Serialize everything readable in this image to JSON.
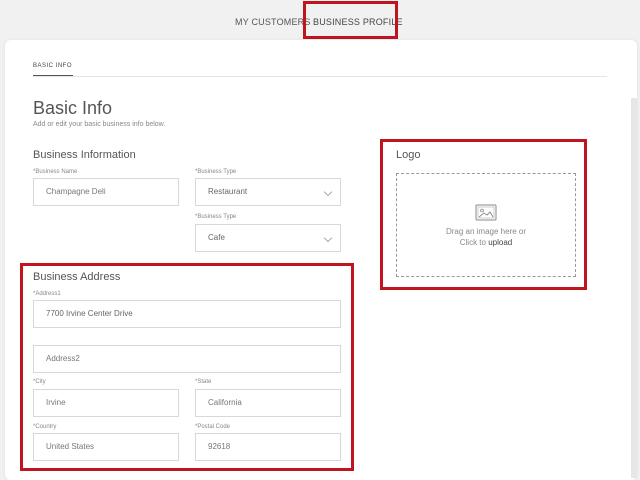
{
  "nav": {
    "tabs": [
      {
        "label": "MY CUSTOMERS"
      },
      {
        "label": "BUSINESS PROFILE"
      }
    ]
  },
  "subtab": {
    "label": "BASIC INFO"
  },
  "page": {
    "title": "Basic Info",
    "subtitle": "Add or edit your basic business info below."
  },
  "business_info": {
    "title": "Business Information",
    "name": {
      "label": "*Business Name",
      "value": "Champagne Deli"
    },
    "type1": {
      "label": "*Business Type",
      "value": "Restaurant"
    },
    "type2": {
      "label": "*Business Type",
      "value": "Cafe"
    }
  },
  "logo": {
    "title": "Logo",
    "drop_text_line1": "Drag an image here or",
    "drop_text_prefix": "Click to ",
    "upload_link": "upload"
  },
  "address": {
    "title": "Business Address",
    "address1": {
      "label": "*Address1",
      "value": "7700 Irvine Center Drive"
    },
    "address2": {
      "placeholder": "Address2"
    },
    "city": {
      "label": "*City",
      "value": "Irvine"
    },
    "state": {
      "label": "*State",
      "value": "California"
    },
    "country": {
      "label": "*Country",
      "value": "United States"
    },
    "postal": {
      "label": "*Postal Code",
      "value": "92618"
    }
  },
  "colors": {
    "highlight": "#c0151f",
    "background": "#f1f1f2",
    "field_border": "#d8d8d8"
  }
}
